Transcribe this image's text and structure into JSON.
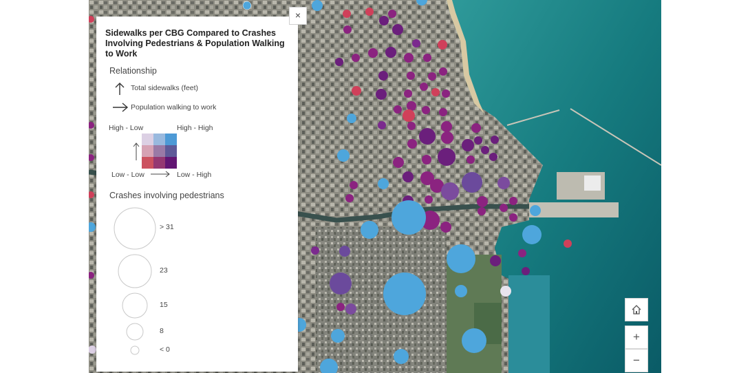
{
  "legend": {
    "title": "Sidewalks per CBG Compared to Crashes Involving Pedestrians & Population Walking to Work",
    "relationship_heading": "Relationship",
    "y_axis_label": "Total sidewalks (feet)",
    "x_axis_label": "Population walking to work",
    "corner_high_low": "High - Low",
    "corner_high_high": "High - High",
    "corner_low_low": "Low - Low",
    "corner_low_high": "Low - High",
    "bivariate_colors": [
      [
        "#dcd0e4",
        "#99b9de",
        "#4d9ad6"
      ],
      [
        "#d6a2b4",
        "#9a7aa6",
        "#5e5a98"
      ],
      [
        "#cc5260",
        "#953872",
        "#621673"
      ]
    ],
    "crashes_heading": "Crashes involving pedestrians",
    "size_classes": [
      {
        "label": "> 31"
      },
      {
        "label": "23"
      },
      {
        "label": "15"
      },
      {
        "label": "8"
      },
      {
        "label": "< 0"
      }
    ],
    "close_icon": "×"
  },
  "map_controls": {
    "home_icon": "home-icon",
    "zoom_in_label": "+",
    "zoom_out_label": "−"
  }
}
